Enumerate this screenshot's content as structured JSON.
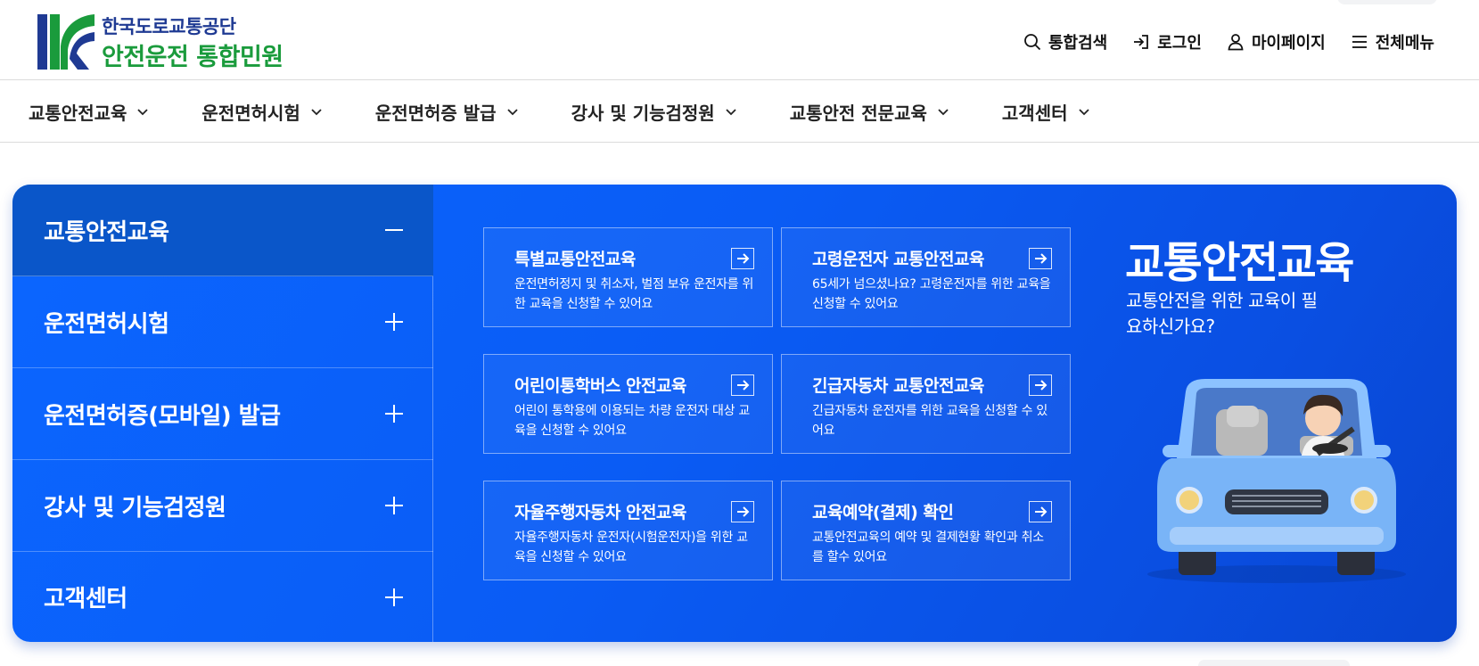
{
  "header": {
    "org_name": "한국도로교통공단",
    "site_name": "안전운전 통합민원",
    "utility": [
      {
        "label": "통합검색",
        "icon": "search-icon"
      },
      {
        "label": "로그인",
        "icon": "login-icon"
      },
      {
        "label": "마이페이지",
        "icon": "user-icon"
      },
      {
        "label": "전체메뉴",
        "icon": "menu-icon"
      }
    ]
  },
  "gnb": {
    "items": [
      {
        "label": "교통안전교육"
      },
      {
        "label": "운전면허시험"
      },
      {
        "label": "운전면허증 발급"
      },
      {
        "label": "강사 및 기능검정원"
      },
      {
        "label": "교통안전 전문교육"
      },
      {
        "label": "고객센터"
      }
    ]
  },
  "side_menu": {
    "items": [
      {
        "label": "교통안전교육",
        "expanded": true
      },
      {
        "label": "운전면허시험",
        "expanded": false
      },
      {
        "label": "운전면허증(모바일) 발급",
        "expanded": false
      },
      {
        "label": "강사 및 기능검정원",
        "expanded": false
      },
      {
        "label": "고객센터",
        "expanded": false
      }
    ]
  },
  "tiles": [
    {
      "title": "특별교통안전교육",
      "desc": "운전면허정지 및 취소자, 벌점 보유 운전자를 위한 교육을 신청할 수 있어요"
    },
    {
      "title": "고령운전자 교통안전교육",
      "desc": "65세가 넘으셨나요? 고령운전자를 위한 교육을 신청할 수 있어요"
    },
    {
      "title": "어린이통학버스 안전교육",
      "desc": "어린이 통학용에 이용되는 차량 운전자 대상 교육을 신청할 수 있어요"
    },
    {
      "title": "긴급자동차 교통안전교육",
      "desc": "긴급자동차 운전자를 위한 교육을 신청할 수 있어요"
    },
    {
      "title": "자율주행자동차 안전교육",
      "desc": "자율주행자동차 운전자(시험운전자)을 위한 교육을 신청할 수 있어요"
    },
    {
      "title": "교육예약(결제) 확인",
      "desc": "교통안전교육의 예약 및 결제현황 확인과 취소를 할수 있어요"
    }
  ],
  "promo": {
    "title": "교통안전교육",
    "subtitle": "교통안전을 위한 교육이 필요하신가요?"
  },
  "colors": {
    "primary_blue": "#0b66ff",
    "active_side": "#0a56c9",
    "logo_green": "#1a9b3c",
    "logo_navy": "#1f3a93"
  }
}
